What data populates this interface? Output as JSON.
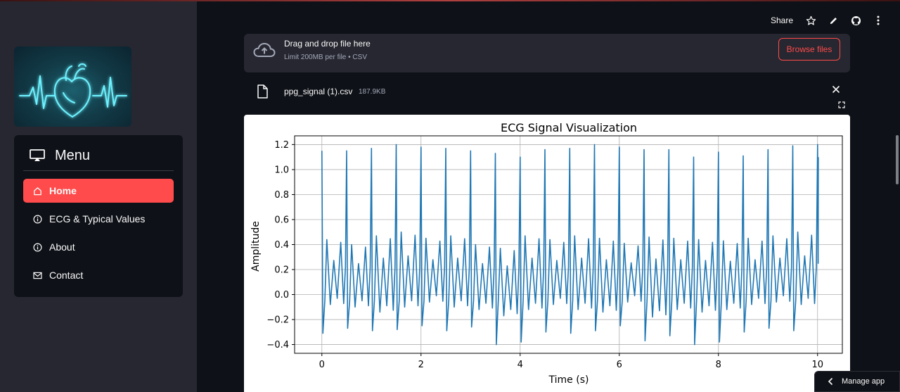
{
  "header": {
    "share_label": "Share",
    "icons": [
      "star-icon",
      "pencil-icon",
      "github-icon",
      "more-vertical-icon"
    ]
  },
  "sidebar": {
    "menu_title": "Menu",
    "items": [
      {
        "label": "Home",
        "icon": "home-icon",
        "active": true
      },
      {
        "label": "ECG & Typical Values",
        "icon": "info-icon",
        "active": false
      },
      {
        "label": "About",
        "icon": "info-icon",
        "active": false
      },
      {
        "label": "Contact",
        "icon": "envelope-icon",
        "active": false
      }
    ]
  },
  "uploader": {
    "title": "Drag and drop file here",
    "subtitle": "Limit 200MB per file • CSV",
    "button_label": "Browse files"
  },
  "file": {
    "name": "ppg_signal (1).csv",
    "size": "187.9KB"
  },
  "manage_app_label": "Manage app",
  "colors": {
    "accent": "#ff4b4b",
    "background": "#0e1117",
    "sidebar": "#262730",
    "line": "#1f77b4"
  },
  "chart_data": {
    "type": "line",
    "title": "ECG Signal Visualization",
    "xlabel": "Time (s)",
    "ylabel": "Amplitude",
    "xlim": [
      -0.55,
      10.5
    ],
    "ylim": [
      -0.47,
      1.27
    ],
    "xticks": [
      0,
      2,
      4,
      6,
      8,
      10
    ],
    "yticks": [
      -0.4,
      -0.2,
      0.0,
      0.2,
      0.4,
      0.6,
      0.8,
      1.0,
      1.2
    ],
    "ytick_labels": [
      "−0.4",
      "−0.2",
      "0.0",
      "0.2",
      "0.4",
      "0.6",
      "0.8",
      "1.0",
      "1.2"
    ],
    "grid": true,
    "series": [
      {
        "beat_interval_s": 0.5,
        "beats": [
          {
            "t": 0.0,
            "peak": 1.15,
            "trough": -0.31
          },
          {
            "t": 0.5,
            "peak": 1.15,
            "trough": -0.27
          },
          {
            "t": 1.0,
            "peak": 1.17,
            "trough": -0.29
          },
          {
            "t": 1.5,
            "peak": 1.2,
            "trough": -0.28
          },
          {
            "t": 2.0,
            "peak": 1.18,
            "trough": -0.25
          },
          {
            "t": 2.5,
            "peak": 1.17,
            "trough": -0.29
          },
          {
            "t": 3.0,
            "peak": 1.15,
            "trough": -0.26
          },
          {
            "t": 3.5,
            "peak": 1.13,
            "trough": -0.4
          },
          {
            "t": 4.0,
            "peak": 1.1,
            "trough": -0.38
          },
          {
            "t": 4.5,
            "peak": 1.16,
            "trough": -0.3
          },
          {
            "t": 5.0,
            "peak": 1.17,
            "trough": -0.31
          },
          {
            "t": 5.5,
            "peak": 1.2,
            "trough": -0.29
          },
          {
            "t": 6.0,
            "peak": 1.18,
            "trough": -0.25
          },
          {
            "t": 6.5,
            "peak": 1.16,
            "trough": -0.37
          },
          {
            "t": 7.0,
            "peak": 1.16,
            "trough": -0.33
          },
          {
            "t": 7.5,
            "peak": 1.1,
            "trough": -0.4
          },
          {
            "t": 8.0,
            "peak": 1.14,
            "trough": -0.38
          },
          {
            "t": 8.5,
            "peak": 1.11,
            "trough": -0.3
          },
          {
            "t": 9.0,
            "peak": 1.16,
            "trough": -0.27
          },
          {
            "t": 9.5,
            "peak": 1.19,
            "trough": -0.29
          },
          {
            "t": 10.0,
            "peak": 1.2,
            "trough": -0.15
          }
        ],
        "mid_wave_peaks": [
          0.44,
          0.4,
          0.47,
          0.5,
          0.45,
          0.47,
          0.4,
          0.37,
          0.47,
          0.44,
          0.47,
          0.45,
          0.41,
          0.46,
          0.45,
          0.44,
          0.43,
          0.45,
          0.47,
          0.5
        ],
        "mid_wave_troughs": [
          -0.08,
          -0.1,
          -0.14,
          -0.1,
          -0.06,
          -0.1,
          -0.12,
          -0.17,
          -0.12,
          -0.08,
          -0.12,
          -0.14,
          -0.06,
          -0.18,
          -0.12,
          -0.14,
          -0.12,
          -0.08,
          -0.06,
          -0.08
        ]
      }
    ]
  }
}
